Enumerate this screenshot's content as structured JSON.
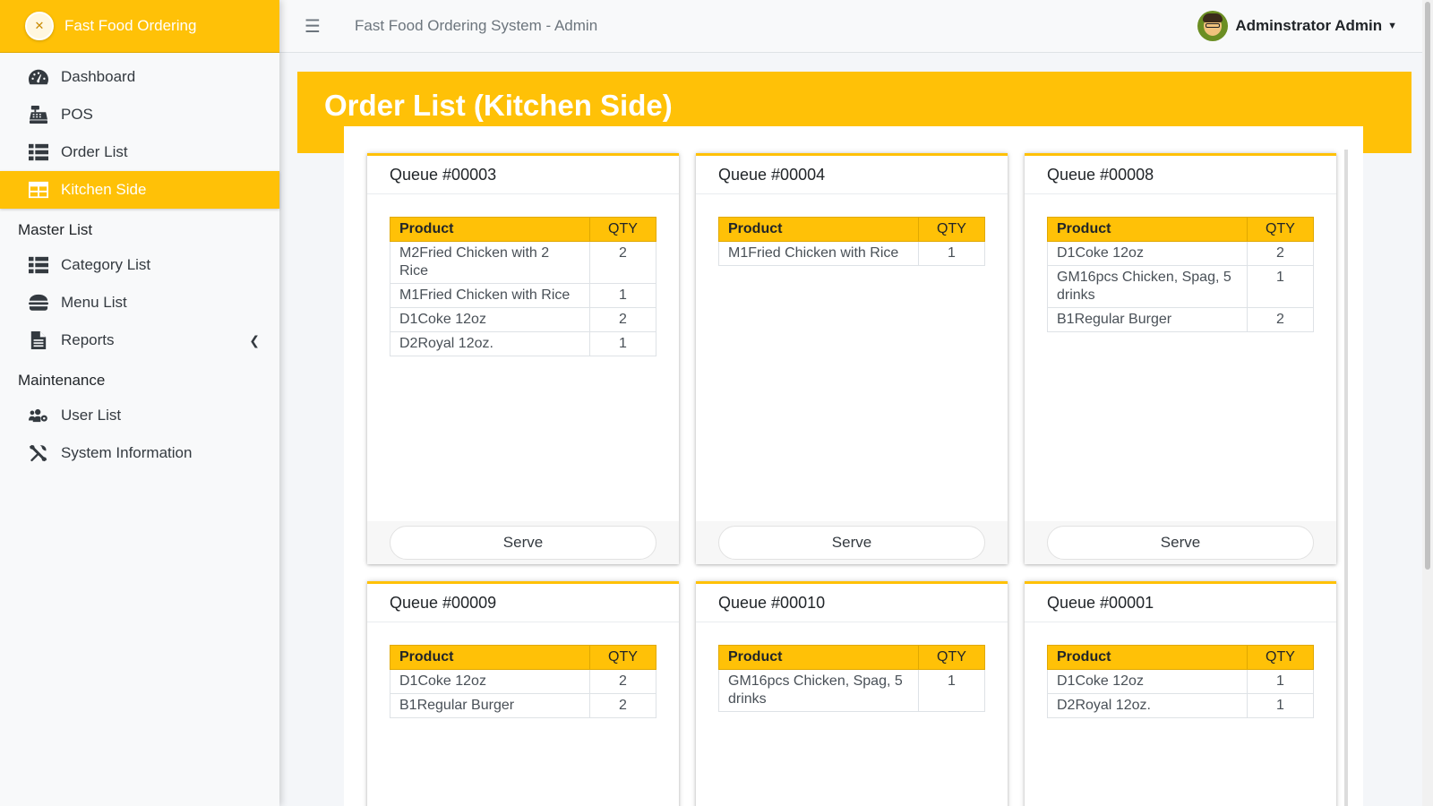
{
  "sidebar": {
    "brand": "Fast Food Ordering",
    "items": [
      {
        "label": "Dashboard"
      },
      {
        "label": "POS"
      },
      {
        "label": "Order List"
      },
      {
        "label": "Kitchen Side"
      }
    ],
    "master_header": "Master List",
    "master_items": [
      {
        "label": "Category List"
      },
      {
        "label": "Menu List"
      },
      {
        "label": "Reports"
      }
    ],
    "maintenance_header": "Maintenance",
    "maintenance_items": [
      {
        "label": "User List"
      },
      {
        "label": "System Information"
      }
    ]
  },
  "topbar": {
    "title": "Fast Food Ordering System - Admin",
    "user": "Adminstrator Admin"
  },
  "page": {
    "title": "Order List (Kitchen Side)",
    "col_product": "Product",
    "col_qty": "QTY",
    "serve_label": "Serve"
  },
  "colors": {
    "accent": "#ffc107",
    "sidebar_bg": "#f8f9fa"
  },
  "orders": [
    {
      "queue": "Queue #00003",
      "items": [
        {
          "product": "M2Fried Chicken with 2 Rice",
          "qty": "2"
        },
        {
          "product": "M1Fried Chicken with Rice",
          "qty": "1"
        },
        {
          "product": "D1Coke 12oz",
          "qty": "2"
        },
        {
          "product": "D2Royal 12oz.",
          "qty": "1"
        }
      ]
    },
    {
      "queue": "Queue #00004",
      "items": [
        {
          "product": "M1Fried Chicken with Rice",
          "qty": "1"
        }
      ]
    },
    {
      "queue": "Queue #00008",
      "items": [
        {
          "product": "D1Coke 12oz",
          "qty": "2"
        },
        {
          "product": "GM16pcs Chicken, Spag, 5 drinks",
          "qty": "1"
        },
        {
          "product": "B1Regular Burger",
          "qty": "2"
        }
      ]
    },
    {
      "queue": "Queue #00009",
      "items": [
        {
          "product": "D1Coke 12oz",
          "qty": "2"
        },
        {
          "product": "B1Regular Burger",
          "qty": "2"
        }
      ]
    },
    {
      "queue": "Queue #00010",
      "items": [
        {
          "product": "GM16pcs Chicken, Spag, 5 drinks",
          "qty": "1"
        }
      ]
    },
    {
      "queue": "Queue #00001",
      "items": [
        {
          "product": "D1Coke 12oz",
          "qty": "1"
        },
        {
          "product": "D2Royal 12oz.",
          "qty": "1"
        }
      ]
    }
  ]
}
